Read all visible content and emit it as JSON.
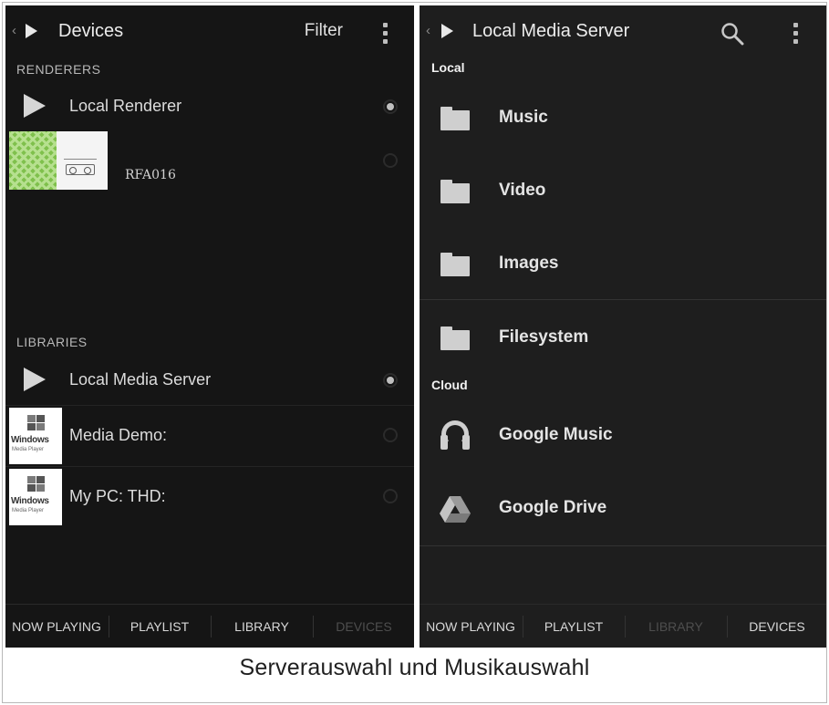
{
  "left_panel": {
    "title": "Devices",
    "filter_label": "Filter",
    "sections": {
      "renderers": "RENDERERS",
      "libraries": "LIBRARIES"
    },
    "renderers": [
      {
        "label": "Local Renderer",
        "selected": true
      },
      {
        "label": "RFA016",
        "selected": false
      }
    ],
    "libraries": [
      {
        "label": "Local Media Server",
        "selected": true
      },
      {
        "label": "Media Demo:",
        "selected": false
      },
      {
        "label": "My PC:  THD:",
        "selected": false
      }
    ],
    "wmp_icon": {
      "line1": "Windows",
      "line2": "Media Player"
    },
    "tabs": [
      {
        "label": "NOW PLAYING",
        "active": false
      },
      {
        "label": "PLAYLIST",
        "active": false
      },
      {
        "label": "LIBRARY",
        "active": false
      },
      {
        "label": "DEVICES",
        "active": true
      }
    ]
  },
  "right_panel": {
    "title": "Local Media Server",
    "sections": {
      "local": "Local",
      "cloud": "Cloud"
    },
    "local_items": [
      {
        "label": "Music",
        "icon": "folder-icon"
      },
      {
        "label": "Video",
        "icon": "folder-icon"
      },
      {
        "label": "Images",
        "icon": "folder-icon"
      },
      {
        "label": "Filesystem",
        "icon": "folder-icon"
      }
    ],
    "cloud_items": [
      {
        "label": "Google Music",
        "icon": "headphones-icon"
      },
      {
        "label": "Google Drive",
        "icon": "google-drive-icon"
      }
    ],
    "tabs": [
      {
        "label": "NOW PLAYING",
        "active": false
      },
      {
        "label": "PLAYLIST",
        "active": false
      },
      {
        "label": "LIBRARY",
        "active": true
      },
      {
        "label": "DEVICES",
        "active": false
      }
    ]
  },
  "caption": "Serverauswahl und Musikauswahl",
  "colors": {
    "panel_bg": "#151515",
    "text": "#e6e6e6",
    "dim_tab": "#4e4e4e"
  }
}
